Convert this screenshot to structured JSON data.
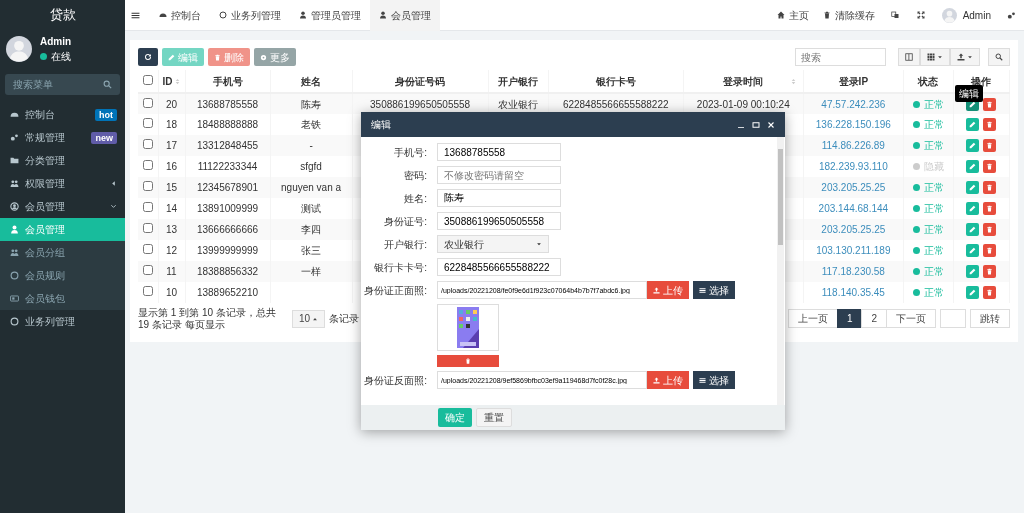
{
  "sidebar": {
    "title": "贷款",
    "user": {
      "name": "Admin",
      "status": "在线"
    },
    "search": {
      "placeholder": "搜索菜单"
    },
    "items": [
      {
        "label": "控制台",
        "selected": false,
        "badge": {
          "text": "hot",
          "color": "#0073b7"
        }
      },
      {
        "label": "常规管理",
        "selected": false,
        "badge": {
          "text": "new",
          "color": "#605ca8"
        }
      },
      {
        "label": "分类管理",
        "selected": false
      },
      {
        "label": "权限管理",
        "selected": false,
        "expanded": false
      },
      {
        "label": "会员管理",
        "selected": false,
        "expanded": true,
        "children": [
          {
            "label": "会员管理",
            "selected": true
          },
          {
            "label": "会员分组",
            "selected": false
          },
          {
            "label": "会员规则",
            "selected": false
          },
          {
            "label": "会员钱包",
            "selected": false
          }
        ]
      },
      {
        "label": "业务列管理",
        "selected": false
      }
    ]
  },
  "top_tabs": [
    {
      "label": "控制台",
      "selected": false
    },
    {
      "label": "业务列管理",
      "selected": false
    },
    {
      "label": "管理员管理",
      "selected": false
    },
    {
      "label": "会员管理",
      "selected": true
    }
  ],
  "top_links": [
    {
      "label": "主页"
    },
    {
      "label": "清除缓存"
    }
  ],
  "top_user": "Admin",
  "toolbar": {
    "buttons": [
      {
        "label": "编辑",
        "kind": "edit",
        "disabled": true
      },
      {
        "label": "删除",
        "kind": "delete",
        "disabled": true
      },
      {
        "label": "更多",
        "kind": "more",
        "disabled": false
      }
    ],
    "search": {
      "placeholder": "搜索"
    }
  },
  "table": {
    "all_checked": false,
    "columns": [
      {
        "label": "ID",
        "sortable": true
      },
      {
        "label": "手机号",
        "sortable": false
      },
      {
        "label": "姓名",
        "sortable": false
      },
      {
        "label": "身份证号码",
        "sortable": false
      },
      {
        "label": "开户银行",
        "sortable": false
      },
      {
        "label": "银行卡号",
        "sortable": false
      },
      {
        "label": "登录时间",
        "sortable": true
      },
      {
        "label": "登录IP",
        "sortable": false
      },
      {
        "label": "状态",
        "sortable": false
      },
      {
        "label": "操作",
        "sortable": false
      }
    ],
    "rows": [
      {
        "checked": false,
        "id": "20",
        "phone": "13688785558",
        "name": "陈寿",
        "id_number": "350886199650505558",
        "bank": "农业银行",
        "card": "6228485566655588222",
        "login_time": "2023-01-09 00:10:24",
        "ip": "47.57.242.236",
        "status": "正常",
        "color": "#18bc9c",
        "tooltip": "编辑"
      },
      {
        "checked": false,
        "id": "18",
        "phone": "18488888888",
        "name": "老铁",
        "ip": "136.228.150.196",
        "status": "正常",
        "color": "#18bc9c"
      },
      {
        "checked": false,
        "id": "17",
        "phone": "13312848455",
        "name": "-",
        "ip": "114.86.226.89",
        "status": "正常",
        "color": "#18bc9c"
      },
      {
        "checked": false,
        "id": "16",
        "phone": "11122233344",
        "name": "sfgfd",
        "ip": "182.239.93.110",
        "status": "隐藏",
        "color": "#cccccc"
      },
      {
        "checked": false,
        "id": "15",
        "phone": "12345678901",
        "name": "nguyen van a",
        "ip": "203.205.25.25",
        "status": "正常",
        "color": "#18bc9c"
      },
      {
        "checked": false,
        "id": "14",
        "phone": "13891009999",
        "name": "测试",
        "ip": "203.144.68.144",
        "status": "正常",
        "color": "#18bc9c"
      },
      {
        "checked": false,
        "id": "13",
        "phone": "13666666666",
        "name": "李四",
        "ip": "203.205.25.25",
        "status": "正常",
        "color": "#18bc9c"
      },
      {
        "checked": false,
        "id": "12",
        "phone": "13999999999",
        "name": "张三",
        "ip": "103.130.211.189",
        "status": "正常",
        "color": "#18bc9c"
      },
      {
        "checked": false,
        "id": "11",
        "phone": "18388856332",
        "name": "一样",
        "ip": "117.18.230.58",
        "status": "正常",
        "color": "#18bc9c"
      },
      {
        "checked": false,
        "id": "10",
        "phone": "13889652210",
        "name": "",
        "ip": "118.140.35.45",
        "status": "正常",
        "color": "#18bc9c"
      }
    ]
  },
  "pagination": {
    "summary": "显示第 1 到第 10 条记录，总共 19 条记录 每页显示",
    "page_size": "10",
    "suffix": "条记录",
    "pages": [
      {
        "label": "上一页",
        "selected": false
      },
      {
        "label": "1",
        "selected": true
      },
      {
        "label": "2",
        "selected": false
      },
      {
        "label": "下一页",
        "selected": false
      }
    ],
    "jump": "跳转"
  },
  "modal": {
    "title": "编辑",
    "fields": [
      {
        "label": "手机号:",
        "kind": "text",
        "value": "13688785558"
      },
      {
        "label": "密码:",
        "kind": "text",
        "placeholder": "不修改密码请留空"
      },
      {
        "label": "姓名:",
        "kind": "text",
        "value": "陈寿"
      },
      {
        "label": "身份证号:",
        "kind": "text",
        "value": "350886199650505558"
      },
      {
        "label": "开户银行:",
        "kind": "select",
        "value": "农业银行"
      },
      {
        "label": "银行卡卡号:",
        "kind": "text",
        "value": "6228485566655588222"
      },
      {
        "label": "身份证正面照:",
        "kind": "upload",
        "value": "/uploads/20221208/fe0f9e6d1f923c07064b4b7b7f7abdc6.jpg",
        "upload": "上传",
        "choose": "选择"
      },
      {
        "label": "身份证反面照:",
        "kind": "upload",
        "value": "/uploads/20221208/9ef5869bfbc03ef9a119468d7fc0f28c.jpg",
        "upload": "上传",
        "choose": "选择"
      }
    ],
    "buttons": [
      {
        "label": "确定",
        "kind": "primary"
      },
      {
        "label": "重置",
        "kind": "default"
      }
    ]
  }
}
